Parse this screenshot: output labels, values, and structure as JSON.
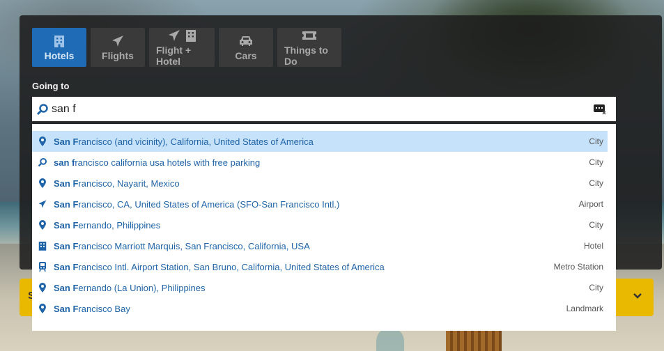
{
  "tabs": [
    {
      "label": "Hotels",
      "icon": "hotel-icon",
      "active": true
    },
    {
      "label": "Flights",
      "icon": "plane-icon",
      "active": false
    },
    {
      "label": "Flight + Hotel",
      "icon": "plane-hotel-icon",
      "active": false
    },
    {
      "label": "Cars",
      "icon": "car-icon",
      "active": false
    },
    {
      "label": "Things to Do",
      "icon": "ticket-icon",
      "active": false
    }
  ],
  "going_to": {
    "label": "Going to",
    "value": "san f"
  },
  "suggestions": [
    {
      "icon": "map-pin-icon",
      "bold": "San F",
      "rest": "rancisco (and vicinity), California, United States of America",
      "type": "City"
    },
    {
      "icon": "search-icon",
      "bold": "san f",
      "rest": "rancisco california usa hotels with free parking",
      "type": "City"
    },
    {
      "icon": "map-pin-icon",
      "bold": "San F",
      "rest": "rancisco, Nayarit, Mexico",
      "type": "City"
    },
    {
      "icon": "plane-icon",
      "bold": "San F",
      "rest": "rancisco, CA, United States of America (SFO-San Francisco Intl.)",
      "type": "Airport"
    },
    {
      "icon": "map-pin-icon",
      "bold": "San F",
      "rest": "ernando, Philippines",
      "type": "City"
    },
    {
      "icon": "hotel-icon",
      "bold": "San F",
      "rest": "rancisco Marriott Marquis, San Francisco, California, USA",
      "type": "Hotel"
    },
    {
      "icon": "train-icon",
      "bold": "San F",
      "rest": "rancisco Intl. Airport Station, San Bruno, California, United States of America",
      "type": "Metro Station"
    },
    {
      "icon": "map-pin-icon",
      "bold": "San F",
      "rest": "ernando (La Union), Philippines",
      "type": "City"
    },
    {
      "icon": "map-pin-icon",
      "bold": "San F",
      "rest": "rancisco Bay",
      "type": "Landmark"
    }
  ],
  "yellow_bar": {
    "letter": "S"
  },
  "colors": {
    "accent": "#1f6bb6",
    "link": "#1f64a8",
    "highlight": "#c6e2fb",
    "yellow": "#e9b800"
  }
}
